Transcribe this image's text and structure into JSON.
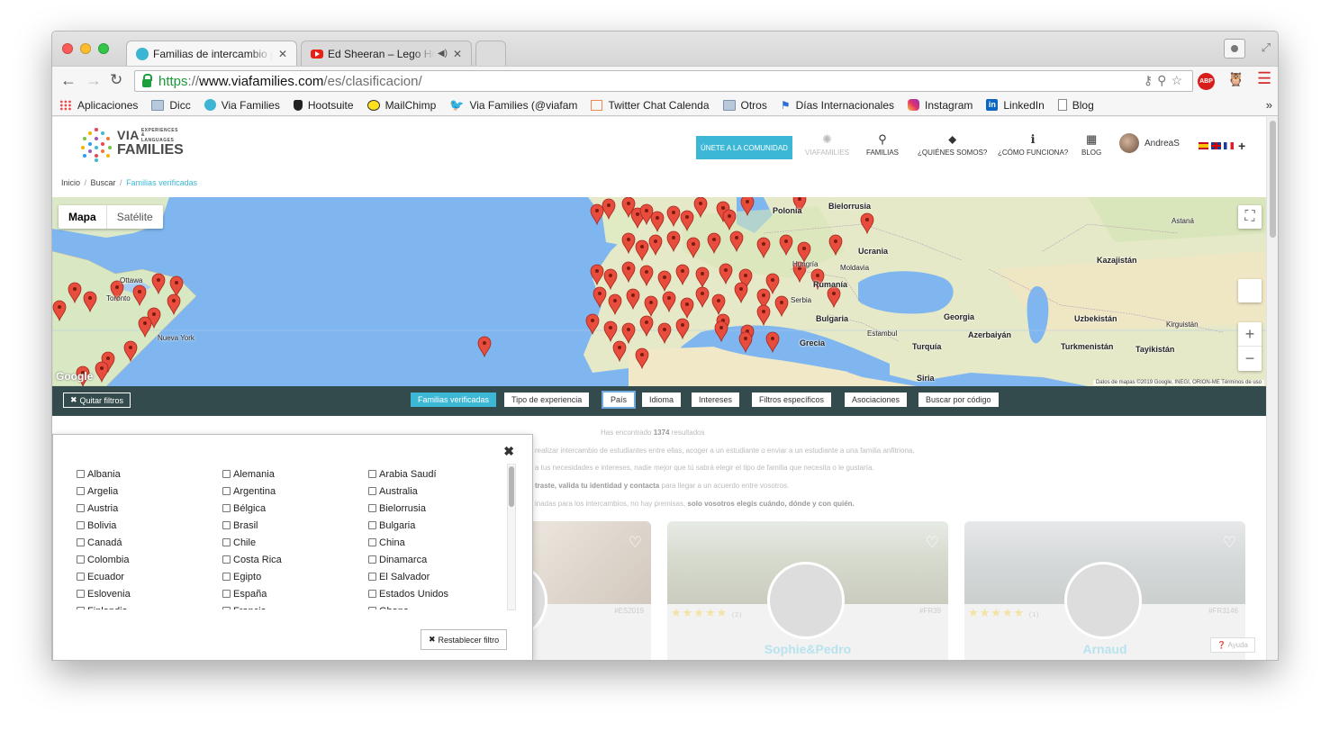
{
  "browser": {
    "tabs": [
      {
        "title": "Familias de intercambio para",
        "active": true
      },
      {
        "title": "Ed Sheeran – Lego House",
        "active": false
      }
    ],
    "url": {
      "scheme": "https",
      "sep": "://",
      "domain": "www.viafamilies.com",
      "path": "/es/clasificacion/"
    },
    "bookmarks": [
      {
        "label": "Aplicaciones",
        "icon": "apps-grid-icon"
      },
      {
        "label": "Dicc",
        "icon": "folder-icon"
      },
      {
        "label": "Via Families",
        "icon": "viafamilies-favicon"
      },
      {
        "label": "Hootsuite",
        "icon": "hootsuite-icon"
      },
      {
        "label": "MailChimp",
        "icon": "mailchimp-icon"
      },
      {
        "label": "Via Families (@viafam",
        "icon": "twitter-icon"
      },
      {
        "label": "Twitter Chat Calenda",
        "icon": "calendar-icon"
      },
      {
        "label": "Otros",
        "icon": "folder-icon"
      },
      {
        "label": "Días Internacionales",
        "icon": "flag-icon"
      },
      {
        "label": "Instagram",
        "icon": "instagram-icon"
      },
      {
        "label": "LinkedIn",
        "icon": "linkedin-icon"
      },
      {
        "label": "Blog",
        "icon": "page-icon"
      }
    ],
    "abp": "ABP"
  },
  "header": {
    "logo_top": "VIA",
    "logo_small": "EXPERIENCES & LANGUAGES",
    "logo_bottom": "FAMILIES",
    "join_label": "ÚNETE A LA COMUNIDAD",
    "nav": [
      {
        "label": "VIAFAMILIES",
        "icon": "sun-icon"
      },
      {
        "label": "FAMILIAS",
        "icon": "search-icon"
      },
      {
        "label": "¿QUIÉNES SOMOS?",
        "icon": "tag-icon"
      },
      {
        "label": "¿CÓMO FUNCIONA?",
        "icon": "info-icon"
      },
      {
        "label": "BLOG",
        "icon": "grid-icon"
      }
    ],
    "user": "AndreaS"
  },
  "breadcrumb": {
    "home": "Inicio",
    "search": "Buscar",
    "current": "Familias verificadas"
  },
  "map": {
    "modes": {
      "map": "Mapa",
      "satellite": "Satélite"
    },
    "google": "Google",
    "attribution": "Datos de mapas ©2019 Google, INEGI, ORION-ME    Términos de uso",
    "labels": [
      {
        "text": "Polonia"
      },
      {
        "text": "Bielorrusia"
      },
      {
        "text": "Ucrania"
      },
      {
        "text": "Kazajistán"
      },
      {
        "text": "Moldavia"
      },
      {
        "text": "Rumanía"
      },
      {
        "text": "Serbia"
      },
      {
        "text": "Bulgaria"
      },
      {
        "text": "Hungría"
      },
      {
        "text": "Georgia"
      },
      {
        "text": "Uzbekistán"
      },
      {
        "text": "Kirguistán"
      },
      {
        "text": "Azerbaiyán"
      },
      {
        "text": "Estambul"
      },
      {
        "text": "Turquía"
      },
      {
        "text": "Grecia"
      },
      {
        "text": "Turkmenistán"
      },
      {
        "text": "Tayikistán"
      },
      {
        "text": "Siria"
      },
      {
        "text": "Toronto"
      },
      {
        "text": "Ottawa"
      },
      {
        "text": "Nueva York"
      },
      {
        "text": "Astaná"
      }
    ]
  },
  "filters": {
    "clear": "Quitar filtros",
    "buttons": [
      {
        "label": "Familias verificadas",
        "state": "on"
      },
      {
        "label": "Tipo de experiencia",
        "state": "off"
      },
      {
        "label": "País",
        "state": "focus"
      },
      {
        "label": "Idioma",
        "state": "off"
      },
      {
        "label": "Intereses",
        "state": "off"
      },
      {
        "label": "Filtros específicos",
        "state": "off"
      },
      {
        "label": "Asociaciones",
        "state": "off"
      },
      {
        "label": "Buscar por código",
        "state": "off"
      }
    ]
  },
  "results": {
    "pre": "Has encontrado ",
    "count": "1374",
    "post": " resultados",
    "line1": "realizar intercambio de estudiantes entre ellas, acoger a un estudiante o enviar a un estudiante a una familia anfitriona.",
    "line2": "a tus necesidades e intereses, nadie mejor que tú sabrá elegir el tipo de familia que necesita o le gustaría.",
    "line3_bold": "traste, valida tu identidad y contacta",
    "line3_rest": " para llegar a un acuerdo entre vosotros.",
    "line4_pre": "inadas para los intercambios, no hay premisas, ",
    "line4_bold": "solo vosotros elegís cuándo, dónde y con quién."
  },
  "cards": [
    {
      "code": "#ES2019",
      "name": "",
      "stars": "",
      "reviews": ""
    },
    {
      "code": "#FR39",
      "name": "Sophie&Pedro",
      "stars": "★★★★★",
      "reviews": "(2)"
    },
    {
      "code": "#FR3146",
      "name": "Arnaud",
      "stars": "★★★★★",
      "reviews": "(1)"
    }
  ],
  "help": "Ayuda",
  "country_panel": {
    "countries": [
      "Albania",
      "Alemania",
      "Arabia Saudí",
      "Argelia",
      "Argentina",
      "Australia",
      "Austria",
      "Bélgica",
      "Bielorrusia",
      "Bolivia",
      "Brasil",
      "Bulgaria",
      "Canadá",
      "Chile",
      "China",
      "Colombia",
      "Costa Rica",
      "Dinamarca",
      "Ecuador",
      "Egipto",
      "El Salvador",
      "Eslovenia",
      "España",
      "Estados Unidos",
      "Finlandia",
      "Francia",
      "Ghana"
    ],
    "reset": "Restablecer filtro"
  }
}
